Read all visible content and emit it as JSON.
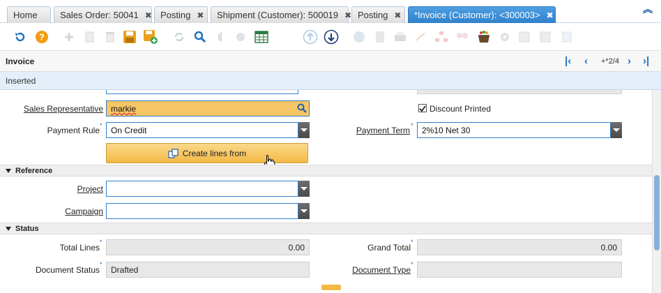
{
  "tabs": [
    {
      "label": "Home",
      "closable": false
    },
    {
      "label": "Sales Order: 50041",
      "closable": true
    },
    {
      "label": "Posting",
      "closable": true
    },
    {
      "label": "Shipment (Customer): 500019",
      "closable": true
    },
    {
      "label": "Posting",
      "closable": true
    },
    {
      "label": "*Invoice (Customer): <300003>",
      "closable": true,
      "active": true
    }
  ],
  "window": {
    "title": "Invoice",
    "record_position": "+*2/4"
  },
  "status": {
    "text": "Inserted"
  },
  "form": {
    "sales_rep_label": "Sales Representative",
    "sales_rep_value": "markie",
    "discount_printed_label": "Discount Printed",
    "discount_printed_checked": true,
    "payment_rule_label": "Payment Rule",
    "payment_rule_value": "On Credit",
    "payment_term_label": "Payment Term",
    "payment_term_value": "2%10 Net 30",
    "create_lines_label": "Create lines from",
    "reference_section": "Reference",
    "project_label": "Project",
    "project_value": "",
    "campaign_label": "Campaign",
    "campaign_value": "",
    "status_section": "Status",
    "total_lines_label": "Total Lines",
    "total_lines_value": "0.00",
    "grand_total_label": "Grand Total",
    "grand_total_value": "0.00",
    "doc_status_label": "Document Status",
    "doc_status_value": "Drafted",
    "doc_type_label": "Document Type",
    "doc_type_value": ""
  },
  "colors": {
    "accent": "#2f82cc",
    "highlight": "#f7c666",
    "button": "#f3b945"
  }
}
